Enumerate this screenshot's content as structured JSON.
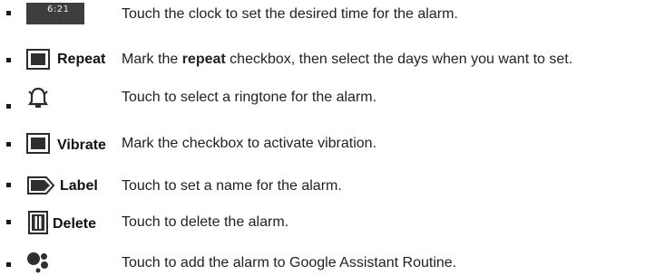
{
  "items": [
    {
      "icon": "clock-preview-icon",
      "label": "",
      "clock_time": "6:21",
      "description": "Touch the clock to set the desired time for the alarm."
    },
    {
      "icon": "checkbox-icon",
      "label": "Repeat",
      "description_parts": [
        "Mark the ",
        "repeat",
        " checkbox, then select the days when you want to set."
      ]
    },
    {
      "icon": "ringtone-bell-icon",
      "label": "",
      "description": "Touch to select a ringtone for the alarm."
    },
    {
      "icon": "checkbox-icon",
      "label": "Vibrate",
      "description": "Mark the checkbox to activate vibration."
    },
    {
      "icon": "label-tag-icon",
      "label": "Label",
      "description": "Touch to set a name for the alarm."
    },
    {
      "icon": "trash-can-icon",
      "label": "Delete",
      "description": "Touch to delete the alarm."
    },
    {
      "icon": "google-assistant-icon",
      "label": "",
      "description": "Touch to add the alarm to Google Assistant Routine."
    }
  ],
  "colors": {
    "text": "#222222",
    "icon_dark": "#2f2f2f",
    "background": "#ffffff"
  }
}
